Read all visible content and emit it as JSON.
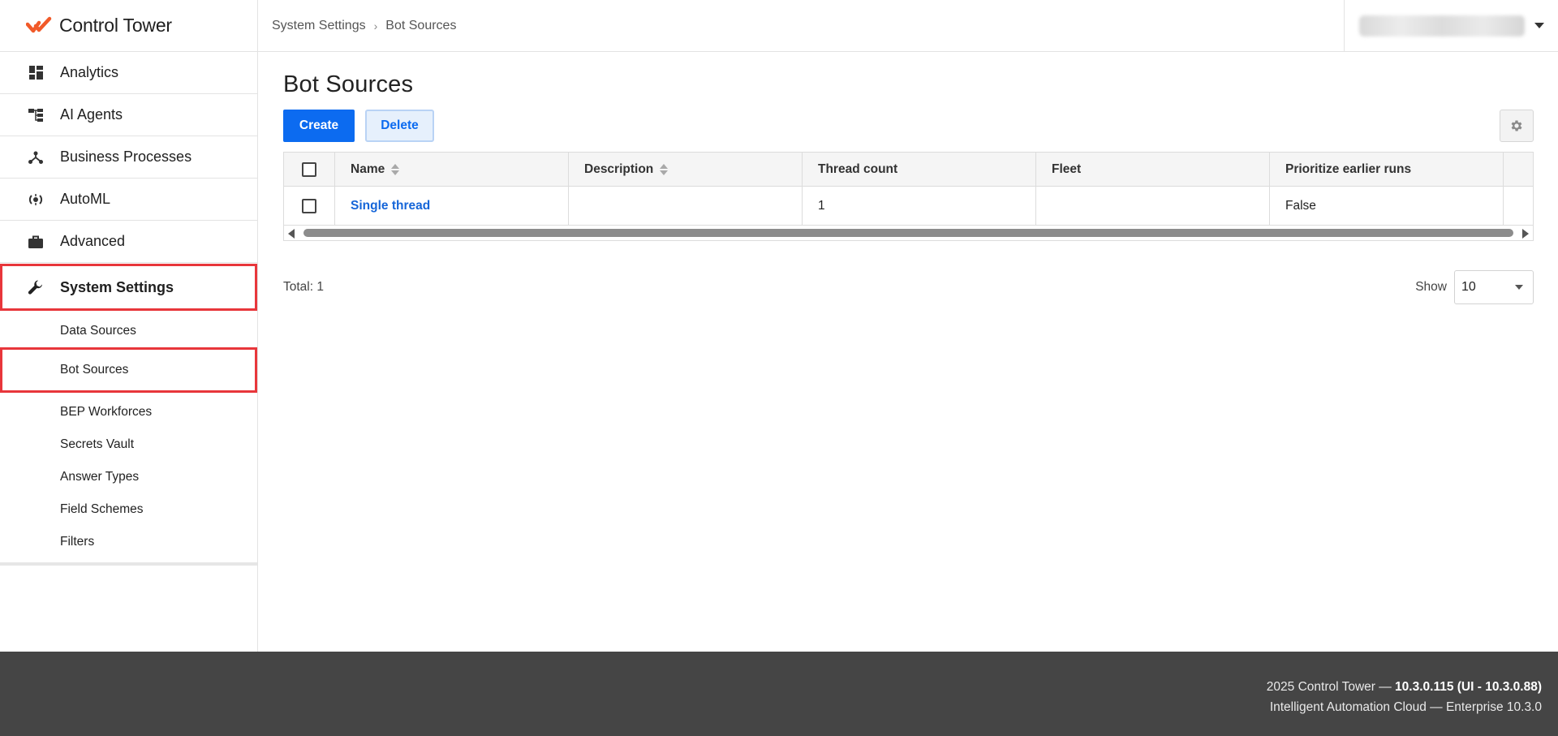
{
  "brand": {
    "name": "Control Tower",
    "accent": "#f15a29"
  },
  "sidebar": {
    "items": [
      {
        "label": "Analytics",
        "icon": "dashboard-icon"
      },
      {
        "label": "AI Agents",
        "icon": "hierarchy-icon"
      },
      {
        "label": "Business Processes",
        "icon": "process-icon"
      },
      {
        "label": "AutoML",
        "icon": "automl-icon"
      },
      {
        "label": "Advanced",
        "icon": "briefcase-icon"
      },
      {
        "label": "System Settings",
        "icon": "wrench-icon",
        "active": true
      }
    ],
    "sub_items": [
      {
        "label": "Data Sources"
      },
      {
        "label": "Bot Sources",
        "active": true
      },
      {
        "label": "BEP Workforces"
      },
      {
        "label": "Secrets Vault"
      },
      {
        "label": "Answer Types"
      },
      {
        "label": "Field Schemes"
      },
      {
        "label": "Filters"
      }
    ]
  },
  "breadcrumb": {
    "parent": "System Settings",
    "current": "Bot Sources"
  },
  "page": {
    "title": "Bot Sources"
  },
  "toolbar": {
    "create_label": "Create",
    "delete_label": "Delete"
  },
  "table": {
    "columns": [
      "Name",
      "Description",
      "Thread count",
      "Fleet",
      "Prioritize earlier runs"
    ],
    "rows": [
      {
        "name": "Single thread",
        "description": "",
        "thread_count": "1",
        "fleet": "",
        "prioritize": "False"
      }
    ]
  },
  "pagination": {
    "total_label": "Total: 1",
    "show_label": "Show",
    "page_size": "10"
  },
  "footer": {
    "line1_prefix": "2025 Control Tower — ",
    "line1_version": "10.3.0.115 (UI - 10.3.0.88)",
    "line2": "Intelligent Automation Cloud — Enterprise 10.3.0"
  },
  "colors": {
    "primary": "#0c6bf0",
    "highlight": "#e8363b",
    "footer_bg": "#454545"
  }
}
